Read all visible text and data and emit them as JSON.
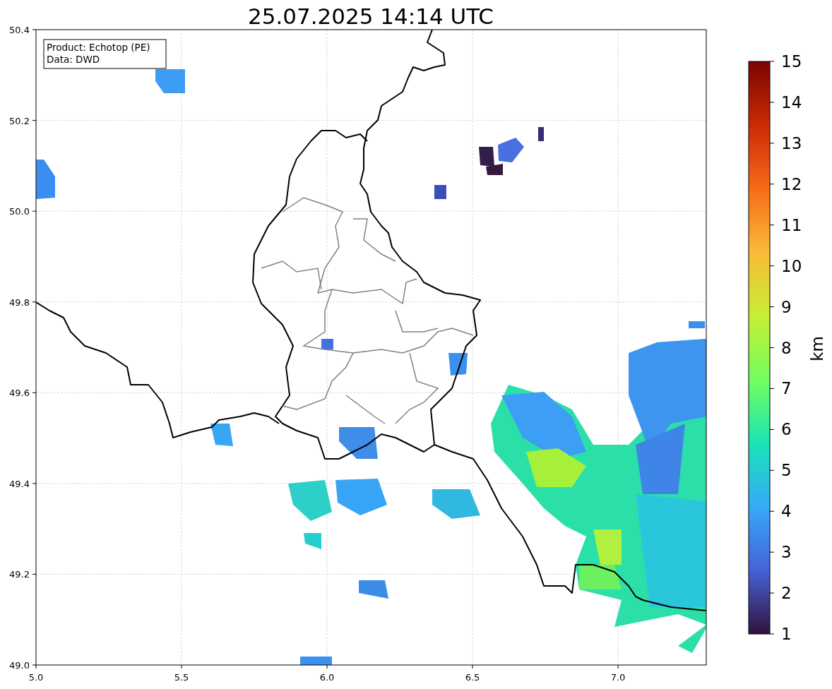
{
  "title": "25.07.2025 14:14 UTC",
  "info_box": [
    "Product: Echotop (PE)",
    "Data: DWD"
  ],
  "x_ticks": [
    "5.0",
    "5.5",
    "6.0",
    "6.5",
    "7.0"
  ],
  "y_ticks": [
    "50.4",
    "50.2",
    "50.0",
    "49.8",
    "49.6",
    "49.4",
    "49.2",
    "49.0"
  ],
  "colorbar": {
    "label": "km",
    "ticks": [
      "15",
      "14",
      "13",
      "12",
      "11",
      "10",
      "9",
      "8",
      "7",
      "6",
      "5",
      "4",
      "3",
      "2",
      "1"
    ]
  }
}
